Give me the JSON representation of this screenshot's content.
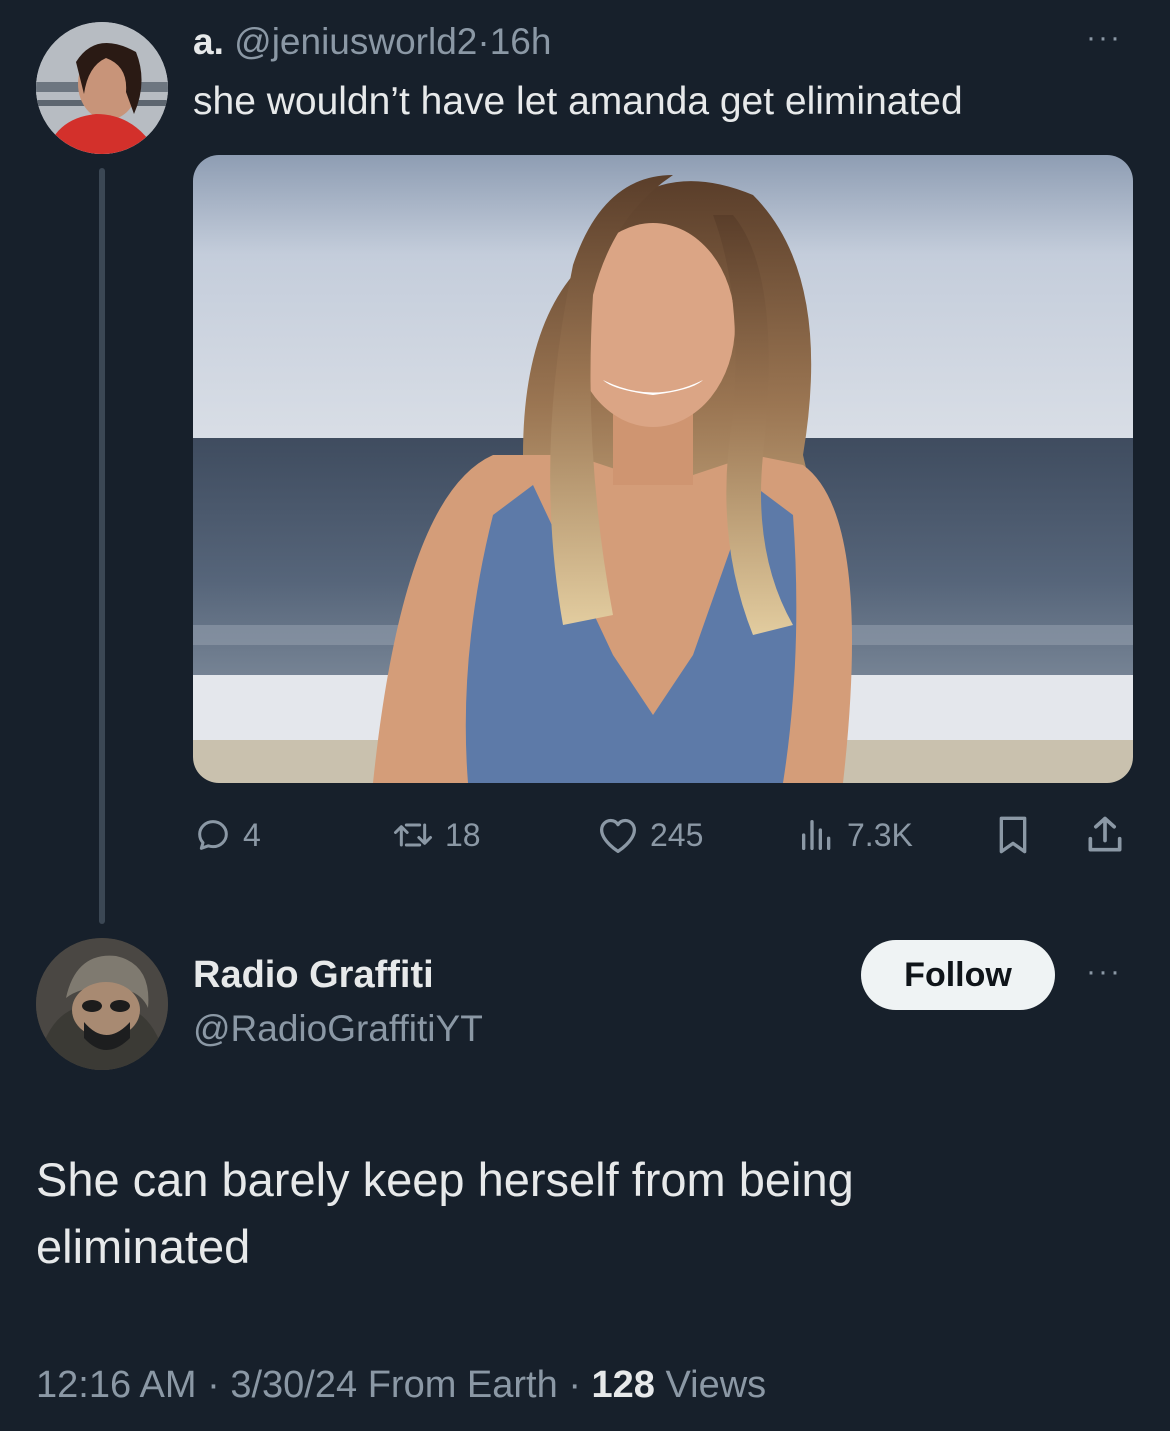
{
  "tweet1": {
    "display_name": "a.",
    "handle": "@jeniusworld2",
    "separator": "·",
    "time": "16h",
    "text": "she wouldn’t have let amanda get eliminated",
    "more_label": "···",
    "actions": {
      "replies": "4",
      "retweets": "18",
      "likes": "245",
      "views": "7.3K"
    }
  },
  "tweet2": {
    "display_name": "Radio Graffiti",
    "handle": "@RadioGraffitiYT",
    "follow_label": "Follow",
    "more_label": "···",
    "text": "She can barely keep herself from being eliminated",
    "time": "12:16 AM",
    "sep1": "·",
    "date": "3/30/24",
    "source": "From Earth",
    "sep2": "·",
    "views_count": "128",
    "views_label": "Views"
  },
  "colors": {
    "background": "#17202b",
    "text_primary": "#e7e9ea",
    "text_secondary": "#8b98a5",
    "thread_line": "#3b4754",
    "follow_bg": "#eff3f4"
  }
}
